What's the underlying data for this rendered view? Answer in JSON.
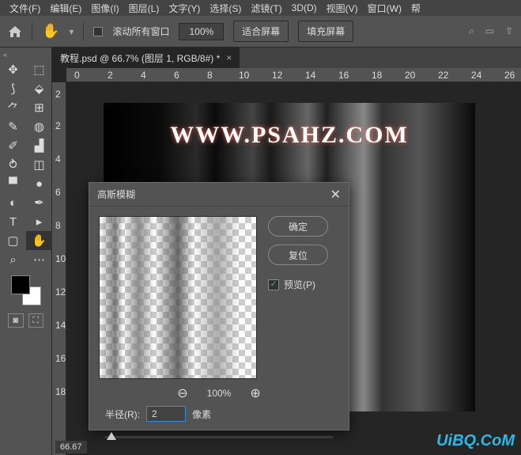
{
  "menu": {
    "file": "文件(F)",
    "edit": "编辑(E)",
    "image": "图像(I)",
    "layer": "图层(L)",
    "type": "文字(Y)",
    "select": "选择(S)",
    "filter": "滤镜(T)",
    "d3": "3D(D)",
    "view": "视图(V)",
    "window": "窗口(W)",
    "help": "帮"
  },
  "options": {
    "scroll_all": "滚动所有窗口",
    "zoom": "100%",
    "fit": "适合屏幕",
    "fill": "填充屏幕"
  },
  "doc": {
    "tab": "教程.psd @ 66.7% (图层 1, RGB/8#) *",
    "zoom_status": "66.67"
  },
  "ruler_h": [
    "0",
    "2",
    "4",
    "6",
    "8",
    "10",
    "12",
    "14",
    "16",
    "18",
    "20",
    "22",
    "24",
    "26"
  ],
  "ruler_v": [
    "2",
    "2",
    "4",
    "6",
    "8",
    "10",
    "12",
    "14",
    "16",
    "18"
  ],
  "canvas": {
    "text": "WWW.PSAHZ.COM"
  },
  "dialog": {
    "title": "高斯模糊",
    "ok": "确定",
    "reset": "复位",
    "preview": "预览(P)",
    "zoom": "100%",
    "radius_label": "半径(R):",
    "radius_value": "2",
    "unit": "像素"
  },
  "watermark": "UiBQ.CoM"
}
